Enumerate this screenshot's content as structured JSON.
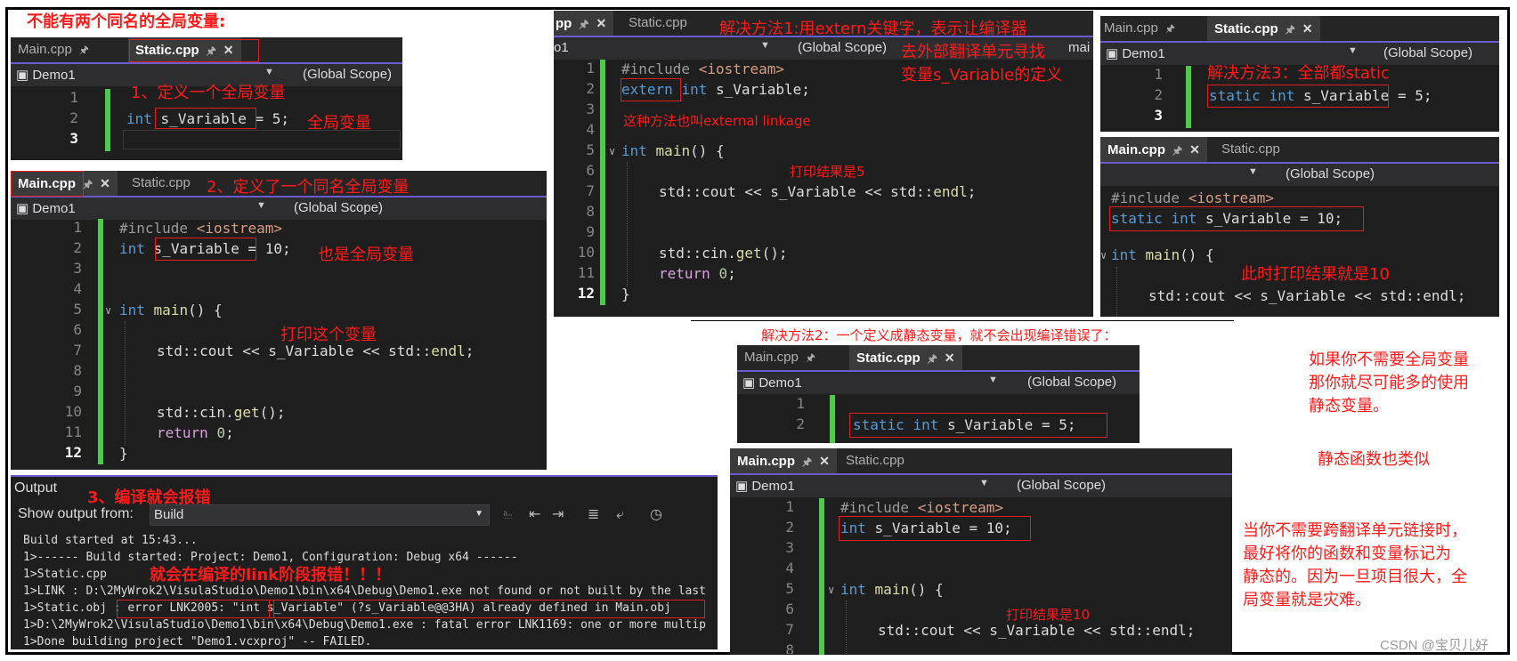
{
  "title": "不能有两个同名的全局变量:",
  "panels": {
    "static1": {
      "tabs": [
        "Main.cpp",
        "Static.cpp"
      ],
      "project": "Demo1",
      "scope": "(Global Scope)",
      "line_numbers": [
        "1",
        "2",
        "3"
      ],
      "code_type": "int",
      "code_var": "s_Variable",
      "code_rest": " = 5;"
    },
    "main1": {
      "tabs": [
        "Main.cpp",
        "Static.cpp"
      ],
      "project": "Demo1",
      "scope": "(Global Scope)",
      "line_numbers": [
        "1",
        "2",
        "3",
        "4",
        "5",
        "6",
        "7",
        "8",
        "9",
        "10",
        "11",
        "12"
      ],
      "lines": {
        "include": "#include",
        "iostream": "<iostream>",
        "int_kw": "int",
        "var": "s_Variable",
        "assign10": " = 10;",
        "main_kw": "int",
        "main_fn": "main",
        "main_rest": "() {",
        "cout": "std::cout << s_Variable << std::",
        "endl": "endl",
        "semi": ";",
        "cin": "std::cin.",
        "get": "get",
        "cin_rest": "();",
        "return_kw": "return",
        "zero": "0",
        "brace": "}"
      }
    },
    "extern_panel": {
      "tabs": [
        "pp",
        "Static.cpp"
      ],
      "project": "o1",
      "scope": "(Global Scope)",
      "line_numbers": [
        "1",
        "2",
        "3",
        "4",
        "5",
        "6",
        "7",
        "8",
        "9",
        "10",
        "11",
        "12"
      ],
      "extern_kw": "extern",
      "rest": " s_Variable;",
      "main_cut": "mai"
    },
    "static3": {
      "tabs": [
        "Main.cpp",
        "Static.cpp"
      ],
      "project": "Demo1",
      "scope": "(Global Scope)",
      "line_numbers": [
        "1",
        "2",
        "3"
      ],
      "static_kw": "static",
      "code_rest": " s_Variable = 5;"
    },
    "main3": {
      "tabs": [
        "Main.cpp",
        "Static.cpp"
      ],
      "scope": "(Global Scope)",
      "static_line_rest": " s_Variable = 10;",
      "cout": "std::cout << s_Variable << std::endl;"
    },
    "static2": {
      "tabs": [
        "Main.cpp",
        "Static.cpp"
      ],
      "project": "Demo1",
      "scope": "(Global Scope)",
      "line_numbers": [
        "1",
        "2"
      ]
    },
    "main2": {
      "tabs": [
        "Main.cpp",
        "Static.cpp"
      ],
      "project": "Demo1",
      "scope": "(Global Scope)",
      "line_numbers": [
        "1",
        "2",
        "3",
        "4",
        "5",
        "6",
        "7",
        "8"
      ],
      "cout": "std::cout << s_Variable << std::endl;"
    }
  },
  "output": {
    "title": "Output",
    "show_from_label": "Show output from:",
    "source": "Build",
    "lines": [
      "Build started at 15:43...",
      "1>------ Build started: Project: Demo1, Configuration: Debug x64 ------",
      "1>Static.cpp",
      "1>LINK : D:\\2MyWrok2\\VisulaStudio\\Demo1\\bin\\x64\\Debug\\Demo1.exe not found or not built by the last",
      "1>Static.obj : error LNK2005: \"int s_Variable\" (?s_Variable@@3HA) already defined in Main.obj",
      "1>D:\\2MyWrok2\\VisulaStudio\\Demo1\\bin\\x64\\Debug\\Demo1.exe : fatal error LNK1169: one or more multip",
      "1>Done building project \"Demo1.vcxproj\" -- FAILED."
    ]
  },
  "annotations": {
    "a1": "1、定义一个全局变量",
    "a1b": "全局变量",
    "a2": "2、定义了一个同名全局变量",
    "a2b": "也是全局变量",
    "a2c": "打印这个变量",
    "a3": "3、编译就会报错",
    "a3b": "就会在编译的link阶段报错！！！",
    "ext1": "解决方法1:用extern关键字，表示让编译器",
    "ext2": "去外部翻译单元寻找",
    "ext3": "变量s_Variable的定义",
    "ext4": "这种方法也叫external linkage",
    "ext5": "打印结果是5",
    "m3": "解决方法3：全部都static",
    "m3b": "此时打印结果就是10",
    "m2": "解决方法2：一个定义成静态变量，就不会出现编译错误了：",
    "m2b": "打印结果是10",
    "r1": "如果你不需要全局变量",
    "r2": "那你就尽可能多的使用",
    "r3": "静态变量。",
    "r4": "静态函数也类似",
    "r5": "当你不需要跨翻译单元链接时，",
    "r6": "最好将你的函数和变量标记为",
    "r7": "静态的。因为一旦项目很大，全",
    "r8": "局变量就是灾难。",
    "watermark": "CSDN @宝贝儿好"
  }
}
